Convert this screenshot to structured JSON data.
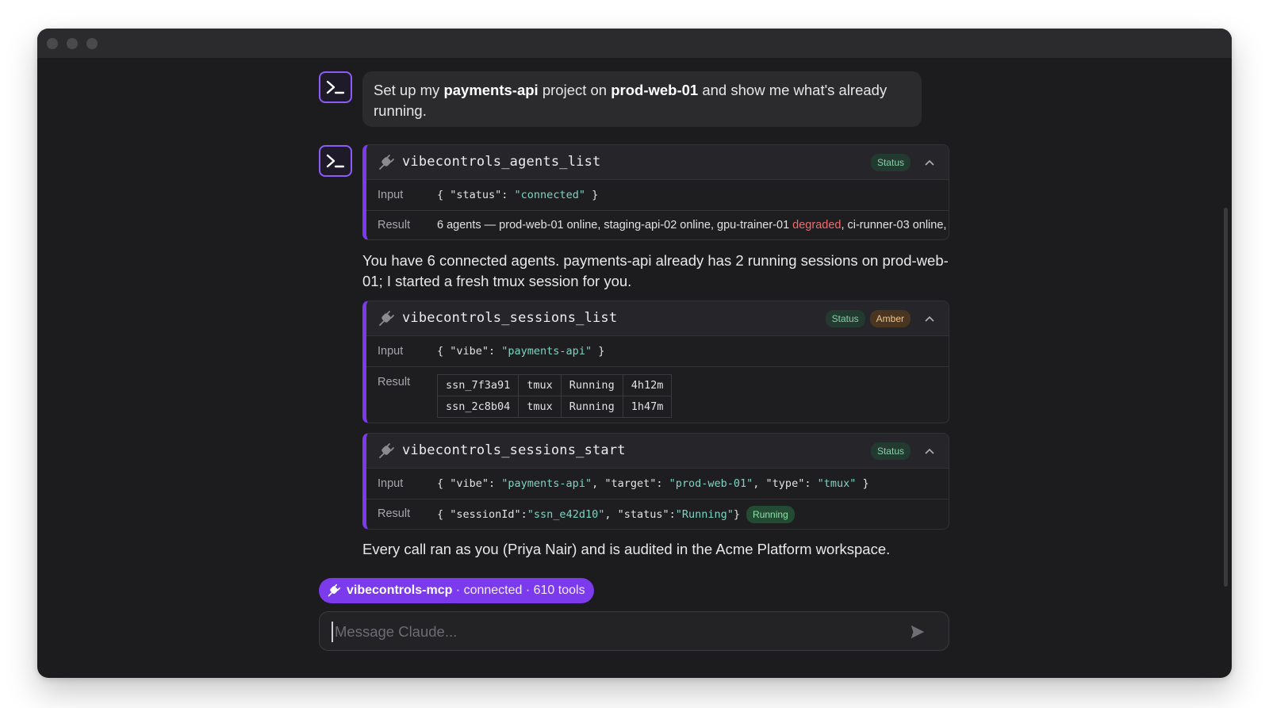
{
  "conversation": {
    "user_message": {
      "p1": "Set up my ",
      "project": "payments-api",
      "p2": " project on ",
      "host": "prod-web-01",
      "p3": " and show me what's already running."
    },
    "tool_calls": [
      {
        "name": "vibecontrols_agents_list",
        "badges": [
          "Status"
        ],
        "input_label": "Input",
        "input": {
          "open": "{ \"status\": ",
          "value": "\"connected\"",
          "close": " }"
        },
        "result_label": "Result",
        "result": {
          "before": "6 agents — prod-web-01 online, staging-api-02 online, gpu-trainer-01 ",
          "degraded": "degraded",
          "after": ", ci-runner-03 online, ..."
        }
      },
      {
        "name": "vibecontrols_sessions_list",
        "badges": [
          "Status",
          "Amber"
        ],
        "input_label": "Input",
        "input": {
          "open": "{ \"vibe\": ",
          "value": "\"payments-api\"",
          "close": " }"
        },
        "result_label": "Result",
        "sessions": [
          [
            "ssn_7f3a91",
            "tmux",
            "Running",
            "4h12m"
          ],
          [
            "ssn_2c8b04",
            "tmux",
            "Running",
            "1h47m"
          ]
        ]
      },
      {
        "name": "vibecontrols_sessions_start",
        "badges": [
          "Status"
        ],
        "input_label": "Input",
        "input": {
          "k1": "{ \"vibe\": ",
          "v1": "\"payments-api\"",
          "k2": ", \"target\": ",
          "v2": "\"prod-web-01\"",
          "k3": ", \"type\": ",
          "v3": "\"tmux\"",
          "close": " }"
        },
        "result_label": "Result",
        "result": {
          "k1": "{ \"sessionId\": ",
          "v1": "\"ssn_e42d10\"",
          "k2": ", \"status\": ",
          "v2": "\"Running\"",
          "close": " }",
          "badge": "Running"
        }
      }
    ],
    "assistant_message_1": "You have 6 connected agents. payments-api already has 2 running sessions on prod-web-01; I started a fresh tmux session for you.",
    "assistant_message_2": "Every call ran as you (Priya Nair) and is audited in the Acme Platform workspace."
  },
  "mcp_status": {
    "server": "vibecontrols-mcp",
    "detail": " · connected · 610 tools"
  },
  "composer": {
    "placeholder": "Message Claude..."
  },
  "icons": {
    "avatar": "terminal-prompt-icon",
    "tool": "plug-icon",
    "collapse": "chevron-up-icon",
    "send": "send-icon"
  },
  "colors": {
    "accent": "#7c3aed",
    "string": "#7dd3c0",
    "degraded": "#f26b6b",
    "status_badge": "#86d0a9",
    "amber_badge": "#f0c58a"
  }
}
